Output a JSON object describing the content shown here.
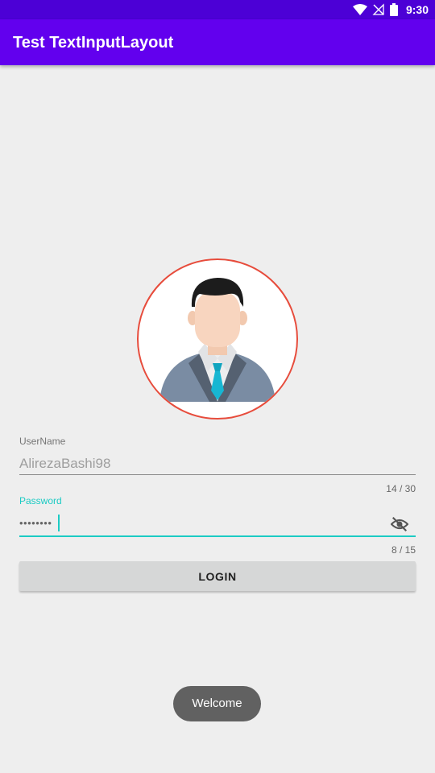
{
  "status_bar": {
    "time": "9:30",
    "icons": [
      "wifi-icon",
      "no-signal-icon",
      "battery-icon"
    ]
  },
  "app_bar": {
    "title": "Test TextInputLayout"
  },
  "avatar": {
    "icon": "businessman-avatar-icon"
  },
  "username": {
    "label": "UserName",
    "value": "AlirezaBashi98",
    "counter": "14 / 30"
  },
  "password": {
    "label": "Password",
    "value": "••••••••",
    "counter": "8 / 15",
    "toggle_icon": "visibility-off-icon"
  },
  "login_button": {
    "label": "LOGIN"
  },
  "toast": {
    "message": "Welcome"
  },
  "colors": {
    "primary": "#6200ee",
    "primary_dark": "#4c00d6",
    "accent": "#1ccbc4",
    "avatar_border": "#e74c3c",
    "background": "#eeeeee"
  }
}
